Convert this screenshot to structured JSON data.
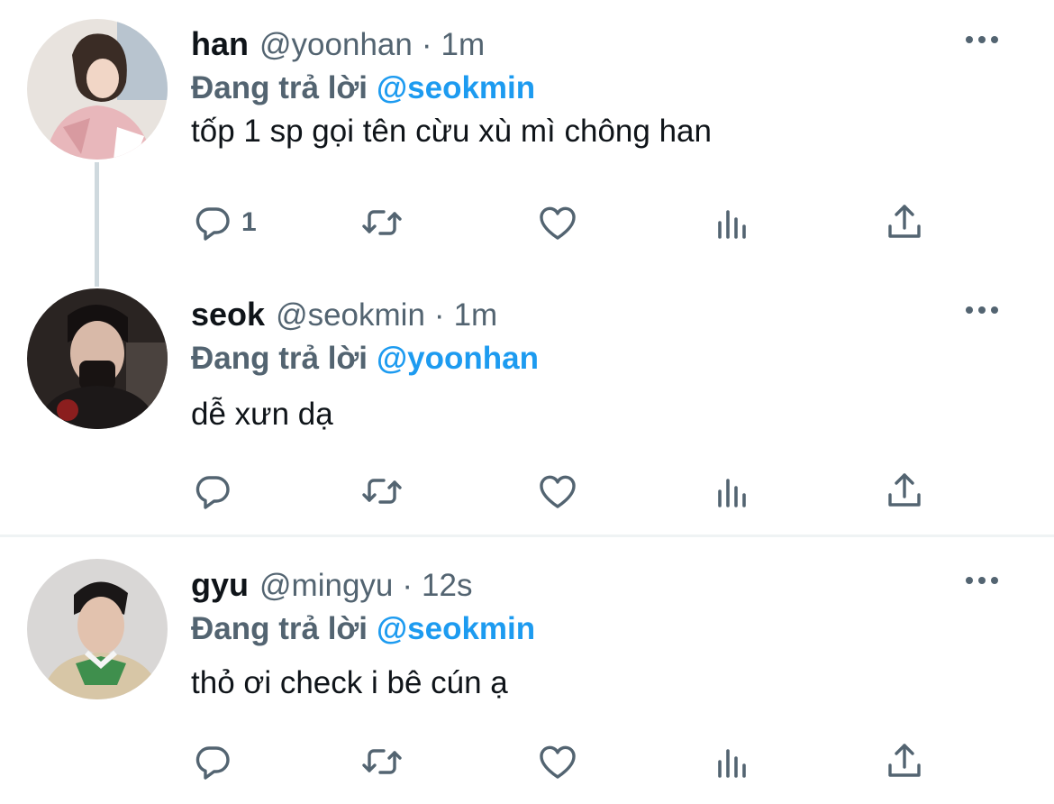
{
  "tweets": [
    {
      "name": "han",
      "handle": "@yoonhan",
      "separator": "·",
      "time": "1m",
      "reply_prefix": "Đang trả lời",
      "reply_to": "@seokmin",
      "text": "tốp 1 sp gọi tên cừu xù mì chông han",
      "reply_count": "1",
      "avatar_bg": "#e8e3de"
    },
    {
      "name": "seok",
      "handle": "@seokmin",
      "separator": "·",
      "time": "1m",
      "reply_prefix": "Đang trả lời",
      "reply_to": "@yoonhan",
      "text": "dễ xưn dạ",
      "reply_count": "",
      "avatar_bg": "#2a2422"
    },
    {
      "name": "gyu",
      "handle": "@mingyu",
      "separator": "·",
      "time": "12s",
      "reply_prefix": "Đang trả lời",
      "reply_to": "@seokmin",
      "text": "thỏ ơi check i bê cún ạ",
      "reply_count": "",
      "avatar_bg": "#d9d7d6"
    }
  ],
  "icons": {
    "reply": "reply-icon",
    "retweet": "retweet-icon",
    "like": "heart-icon",
    "views": "analytics-icon",
    "share": "share-icon",
    "more": "more-icon"
  },
  "colors": {
    "link": "#1d9bf0",
    "secondary": "#536471",
    "primary_text": "#0f1419",
    "thread_line": "#cfd9de",
    "divider": "#eff3f4"
  }
}
